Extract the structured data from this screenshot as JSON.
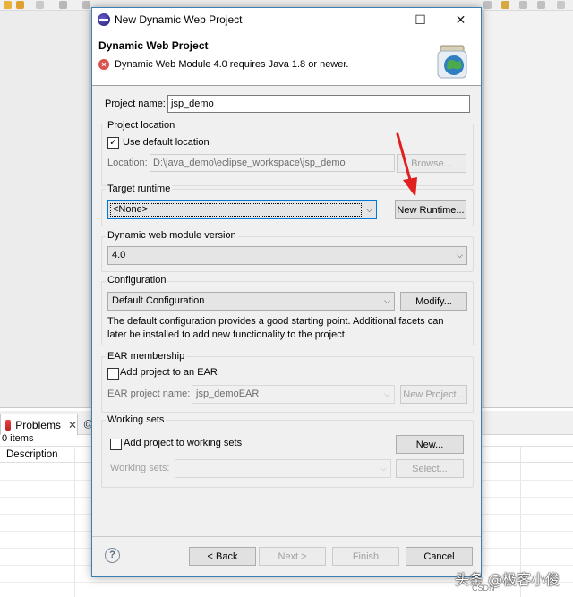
{
  "ide": {
    "problems_tab_label": "Problems",
    "console_tab_label": "@",
    "items_count": "0 items",
    "description_header": "Description"
  },
  "dialog": {
    "window_title": "New Dynamic Web Project",
    "header_title": "Dynamic Web Project",
    "header_error": "Dynamic Web Module 4.0 requires Java 1.8 or newer.",
    "project_name_label": "Project name:",
    "project_name_value": "jsp_demo",
    "project_location": {
      "group_title": "Project location",
      "use_default_label": "Use default location",
      "use_default_checked": true,
      "location_label": "Location:",
      "location_value": "D:\\java_demo\\eclipse_workspace\\jsp_demo",
      "browse_label": "Browse..."
    },
    "target_runtime": {
      "group_title": "Target runtime",
      "selected": "<None>",
      "new_runtime_label": "New Runtime..."
    },
    "module_version": {
      "group_title": "Dynamic web module version",
      "selected": "4.0"
    },
    "configuration": {
      "group_title": "Configuration",
      "selected": "Default Configuration",
      "modify_label": "Modify...",
      "description_line1": "The default configuration provides a good starting point. Additional facets can",
      "description_line2": "later be installed to add new functionality to the project."
    },
    "ear_membership": {
      "group_title": "EAR membership",
      "add_to_ear_label": "Add project to an EAR",
      "add_to_ear_checked": false,
      "ear_name_label": "EAR project name:",
      "ear_name_value": "jsp_demoEAR",
      "new_project_label": "New Project..."
    },
    "working_sets": {
      "group_title": "Working sets",
      "add_label": "Add project to working sets",
      "add_checked": false,
      "new_label": "New...",
      "working_sets_label": "Working sets:",
      "working_sets_value": "",
      "select_label": "Select..."
    },
    "footer": {
      "back_label": "< Back",
      "next_label": "Next >",
      "finish_label": "Finish",
      "cancel_label": "Cancel"
    }
  },
  "watermark": {
    "main": "头条 @极客小俊",
    "sub": "CSDN"
  },
  "colors": {
    "dialog_border": "#3c7fb1",
    "error_icon": "#d9534f",
    "annotation_arrow": "#e02020",
    "focus_border": "#0078d7"
  }
}
